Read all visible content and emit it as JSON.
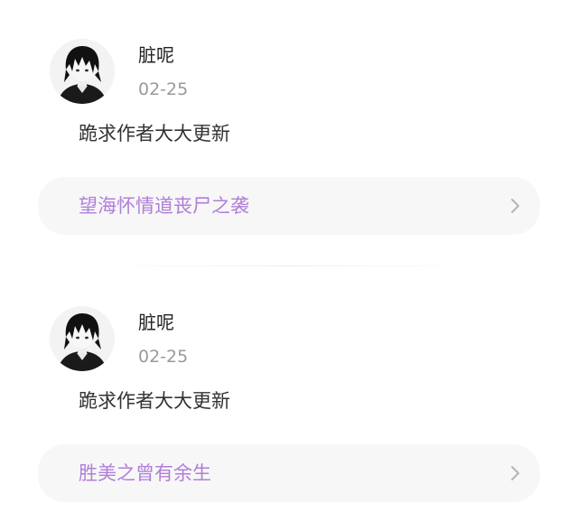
{
  "comments": [
    {
      "username": "脏呢",
      "date": "02-25",
      "text": "跪求作者大大更新",
      "book_title": "望海怀情道丧尸之袭"
    },
    {
      "username": "脏呢",
      "date": "02-25",
      "text": "跪求作者大大更新",
      "book_title": "胜美之曾有余生"
    }
  ],
  "colors": {
    "book_title": "#b07fd8",
    "card_background": "#f7f7f8",
    "date": "#9a9a9a"
  },
  "icons": {
    "avatar": "anime-avatar-icon",
    "chevron": "chevron-right-icon"
  }
}
